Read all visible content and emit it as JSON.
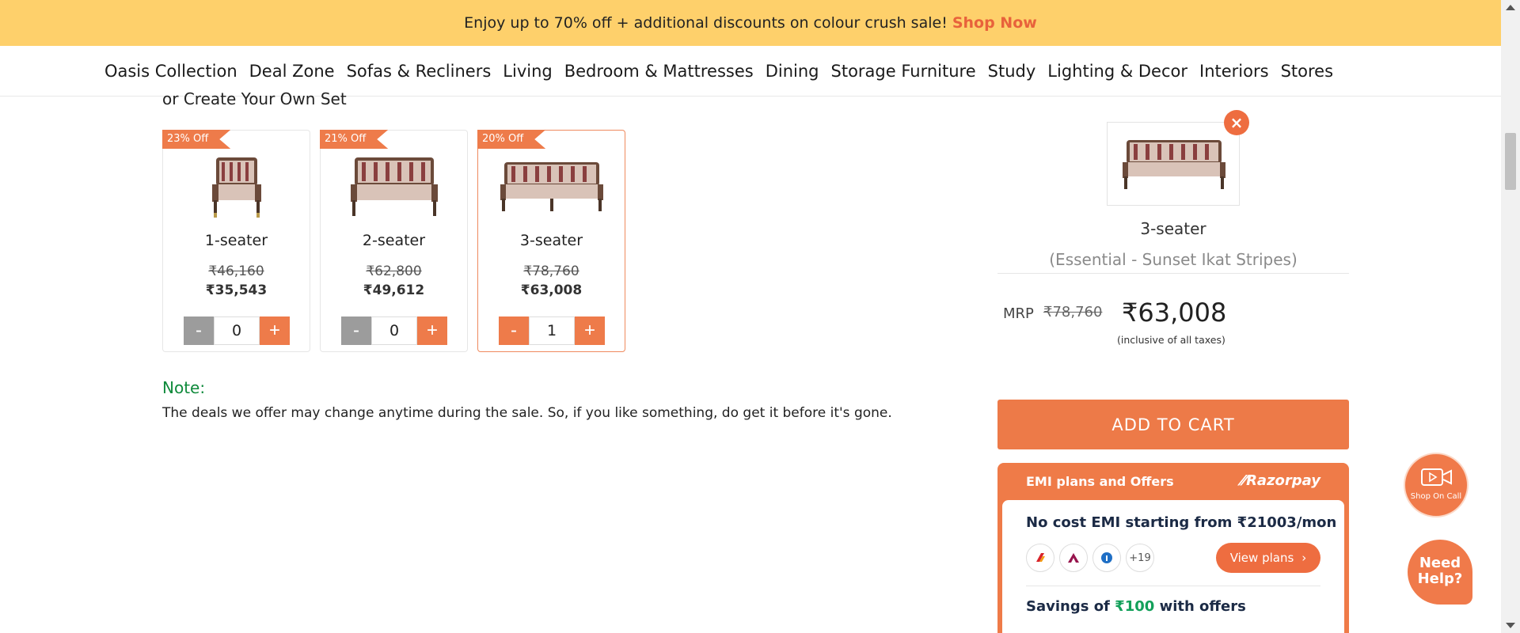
{
  "promo": {
    "text": "Enjoy up to 70% off + additional discounts on colour crush sale!",
    "cta": "Shop Now"
  },
  "nav": {
    "items": [
      "Oasis Collection",
      "Deal Zone",
      "Sofas & Recliners",
      "Living",
      "Bedroom & Mattresses",
      "Dining",
      "Storage Furniture",
      "Study",
      "Lighting & Decor",
      "Interiors",
      "Stores"
    ]
  },
  "set_heading": "or Create Your Own Set",
  "cards": [
    {
      "discount": "23% Off",
      "title": "1-seater",
      "mrp": "₹46,160",
      "price": "₹35,543",
      "qty": "0",
      "minus": "-",
      "plus": "+"
    },
    {
      "discount": "21% Off",
      "title": "2-seater",
      "mrp": "₹62,800",
      "price": "₹49,612",
      "qty": "0",
      "minus": "-",
      "plus": "+"
    },
    {
      "discount": "20% Off",
      "title": "3-seater",
      "mrp": "₹78,760",
      "price": "₹63,008",
      "qty": "1",
      "minus": "-",
      "plus": "+"
    }
  ],
  "note": {
    "label": "Note:",
    "text": "The deals we offer may change anytime during the sale. So, if you like something, do get it before it's gone."
  },
  "selected": {
    "close": "×",
    "title": "3-seater",
    "variant": "(Essential - Sunset Ikat Stripes)",
    "mrp_label": "MRP",
    "mrp": "₹78,760",
    "price": "₹63,008",
    "tax_note": "(inclusive of all taxes)"
  },
  "add_to_cart": "ADD TO CART",
  "emi": {
    "header": "EMI plans and Offers",
    "brand": "Razorpay",
    "line": "No cost EMI starting from ₹21003/mon",
    "more_banks": "+19",
    "view_plans": "View plans",
    "savings_prefix": "Savings of",
    "savings_amount": "₹100",
    "savings_suffix": "with offers"
  },
  "floating": {
    "shop_on_call": "Shop On Call",
    "need_help": "Need Help?"
  },
  "colors": {
    "accent": "#ee7b4a",
    "promo_bg": "#fed06b",
    "note_green": "#0f8a3b"
  }
}
